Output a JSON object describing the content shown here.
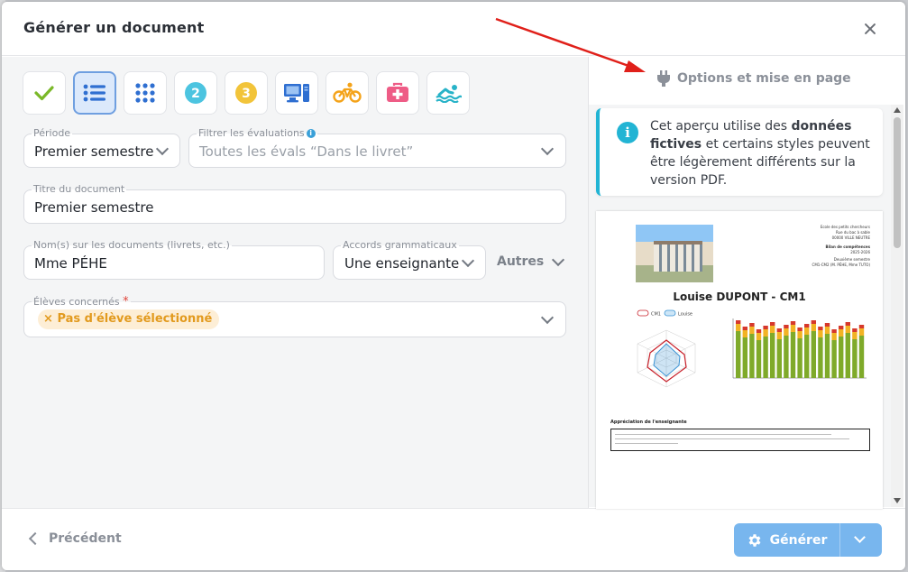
{
  "dialog": {
    "title": "Générer un document"
  },
  "type_buttons": [
    {
      "name": "check-icon",
      "color": "#7ab828",
      "active": false
    },
    {
      "name": "list-icon",
      "color": "#2f6fd1",
      "active": true
    },
    {
      "name": "grid-icon",
      "color": "#2f6fd1",
      "active": false
    },
    {
      "name": "number-2-icon",
      "label": "2",
      "color": "#4cc4e0",
      "active": false
    },
    {
      "name": "number-3-icon",
      "label": "3",
      "color": "#f2c43a",
      "active": false
    },
    {
      "name": "computer-icon",
      "color": "#2f6fd1",
      "active": false
    },
    {
      "name": "bicycle-icon",
      "color": "#f4a31a",
      "active": false
    },
    {
      "name": "medical-kit-icon",
      "color": "#ee5c86",
      "active": false
    },
    {
      "name": "swimming-icon",
      "color": "#28b3c8",
      "active": false
    }
  ],
  "form": {
    "periode": {
      "label": "Période",
      "value": "Premier semestre"
    },
    "filtre": {
      "label": "Filtrer les évaluations",
      "info": "i",
      "placeholder": "Toutes les évals “Dans le livret”"
    },
    "titre": {
      "label": "Titre du document",
      "value": "Premier semestre"
    },
    "noms": {
      "label": "Nom(s) sur les documents (livrets, etc.)",
      "value": "Mme PÉHE"
    },
    "accords": {
      "label": "Accords grammaticaux",
      "value": "Une enseignante"
    },
    "autres_label": "Autres",
    "eleves": {
      "label": "Élèves concernés",
      "required_mark": "*",
      "chip": "Pas d'élève sélectionné",
      "chip_remove": "×"
    }
  },
  "right_panel": {
    "options_label": "Options et mise en page",
    "info": {
      "icon": "i",
      "text_1": "Cet aperçu utilise des ",
      "text_bold": "données fictives",
      "text_2": " et certains styles peuvent être légèrement différents sur la version PDF."
    },
    "preview": {
      "school": "Ecole des petits chercheurs",
      "address_1": "Rue du bac à sable",
      "address_2": "00000 VILLE NEUTRE",
      "bilan": "Bilan de compétences",
      "year": "2025-2026",
      "period": "Deuxième semestre",
      "class": "CM1-CM2 (M. PÉHE, Mme TUTO)",
      "student": "Louise DUPONT - CM1",
      "legend_1": "CM1",
      "legend_2": "Louise",
      "appreciation_title": "Appréciation de l'enseignante"
    }
  },
  "footer": {
    "previous_label": "Précédent",
    "generate_label": "Générer"
  },
  "colors": {
    "accent": "#78b6ee",
    "info": "#22b4d4",
    "warning_chip": "#e29a1e",
    "annotation_arrow": "#e0201a"
  }
}
